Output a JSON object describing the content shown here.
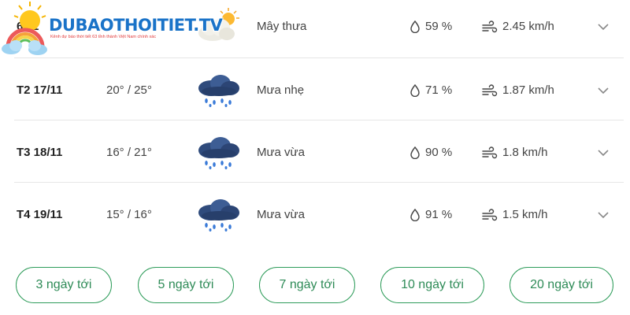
{
  "logo": {
    "text": "DUBAOTHOITIET.TV",
    "tagline": "Kênh dự báo thời tiết 63 tỉnh thành Việt Nam chính xác"
  },
  "forecast": [
    {
      "day": "6/11",
      "temp": "",
      "condition": "Mây thưa",
      "icon": "partly-cloudy-sun-icon",
      "humidity": "59 %",
      "wind": "2.45 km/h"
    },
    {
      "day": "T2 17/11",
      "temp": "20° / 25°",
      "condition": "Mưa nhẹ",
      "icon": "rain-cloud-icon",
      "humidity": "71 %",
      "wind": "1.87 km/h"
    },
    {
      "day": "T3 18/11",
      "temp": "16° / 21°",
      "condition": "Mưa vừa",
      "icon": "rain-cloud-icon",
      "humidity": "90 %",
      "wind": "1.8 km/h"
    },
    {
      "day": "T4 19/11",
      "temp": "15° / 16°",
      "condition": "Mưa vừa",
      "icon": "rain-cloud-icon",
      "humidity": "91 %",
      "wind": "1.5 km/h"
    }
  ],
  "range_buttons": [
    "3 ngày tới",
    "5 ngày tới",
    "7 ngày tới",
    "10 ngày tới",
    "20 ngày tới"
  ],
  "colors": {
    "accent": "#2e9c5a",
    "logo_blue": "#1a73c8",
    "rain_drop": "#3b7bd8"
  }
}
